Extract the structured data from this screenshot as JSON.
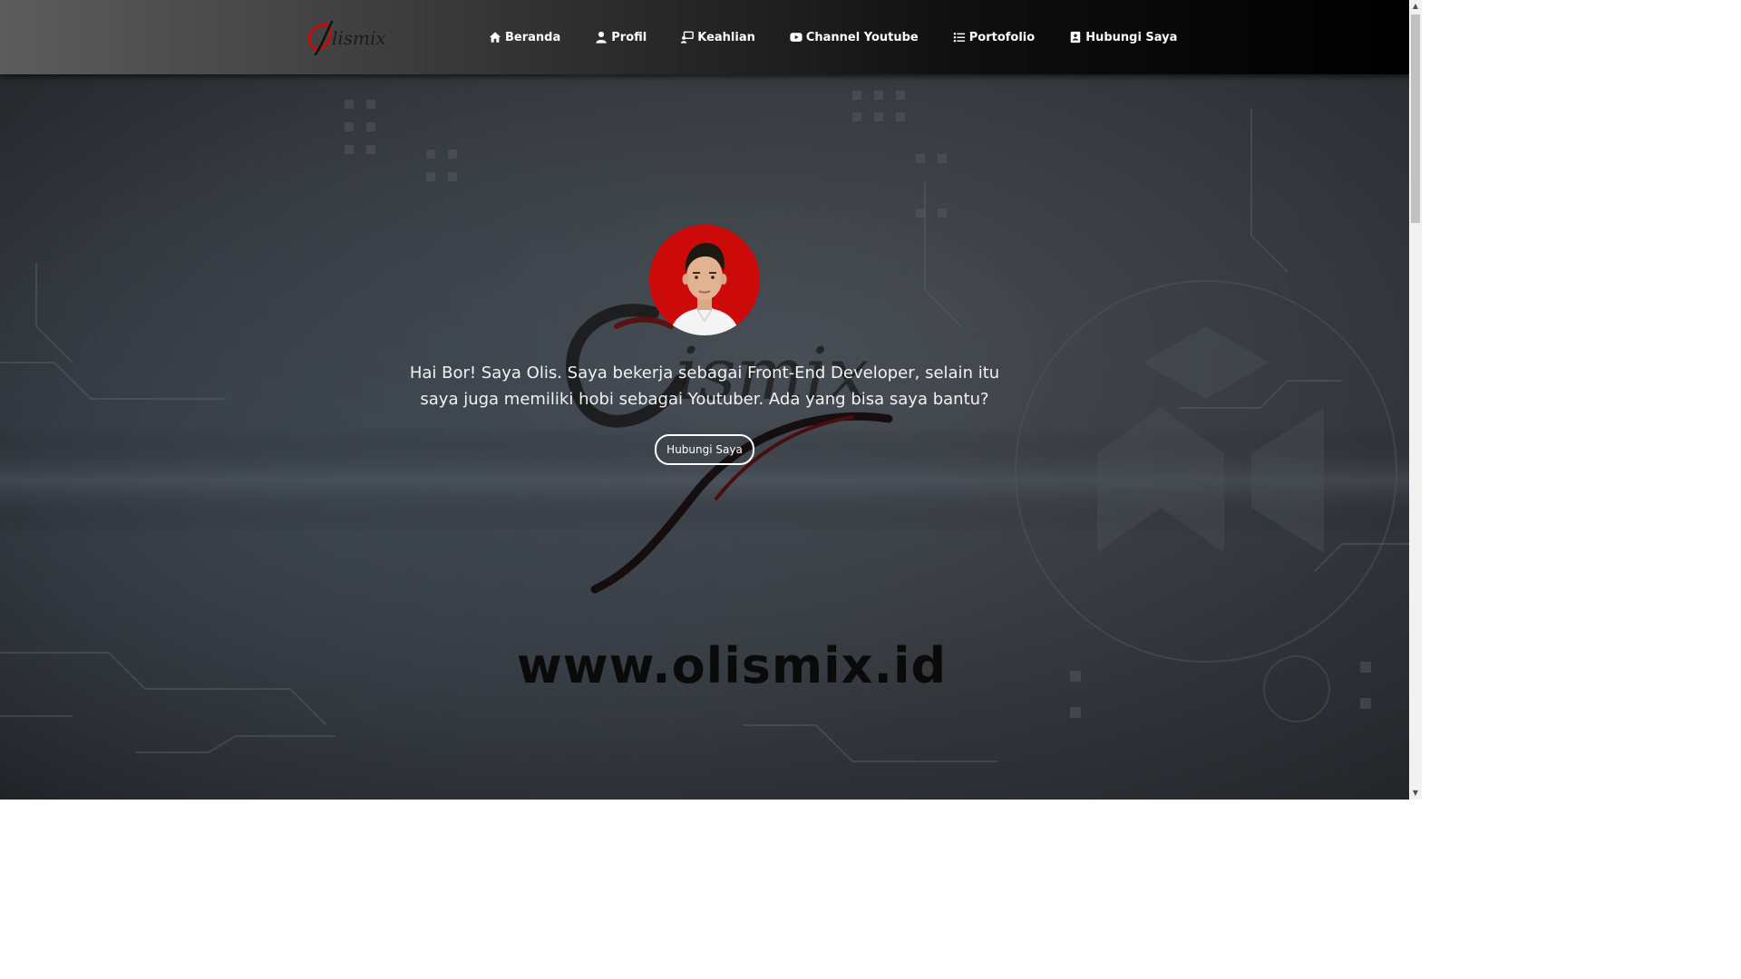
{
  "header": {
    "logo_text": "Olismix",
    "nav": [
      {
        "label": "Beranda",
        "icon": "home-icon"
      },
      {
        "label": "Profil",
        "icon": "user-icon"
      },
      {
        "label": "Keahlian",
        "icon": "chalkboard-user-icon"
      },
      {
        "label": "Channel Youtube",
        "icon": "youtube-icon"
      },
      {
        "label": "Portofolio",
        "icon": "list-icon"
      },
      {
        "label": "Hubungi Saya",
        "icon": "address-book-icon"
      }
    ]
  },
  "hero": {
    "intro_text": "Hai Bor! Saya Olis. Saya bekerja sebagai Front-End Developer, selain itu saya juga memiliki hobi sebagai Youtuber. Ada yang bisa saya bantu?",
    "button_label": "Hubungi Saya",
    "watermark_text": "Olismix",
    "site_url": "www.olismix.id"
  },
  "colors": {
    "accent": "#cc0a0a",
    "navbar": "#000000",
    "text": "#ffffff"
  }
}
